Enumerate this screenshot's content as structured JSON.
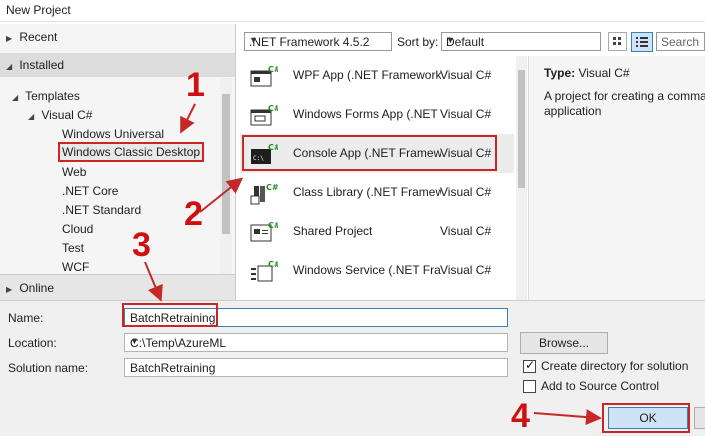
{
  "window": {
    "title": "New Project"
  },
  "left_panel": {
    "recent": "Recent",
    "installed": "Installed",
    "templates": "Templates",
    "visual_csharp": "Visual C#",
    "items": [
      "Windows Universal",
      "Windows Classic Desktop",
      "Web",
      ".NET Core",
      ".NET Standard",
      "Cloud",
      "Test",
      "WCF"
    ],
    "online": "Online"
  },
  "toolbar": {
    "framework": ".NET Framework 4.5.2",
    "sort_label": "Sort by:",
    "sort_value": "Default",
    "search_placeholder": "Search"
  },
  "templates": [
    {
      "name": "WPF App (.NET Framework)",
      "lang": "Visual C#"
    },
    {
      "name": "Windows Forms App (.NET Framework)",
      "lang": "Visual C#"
    },
    {
      "name": "Console App (.NET Framework)",
      "lang": "Visual C#"
    },
    {
      "name": "Class Library (.NET Framework)",
      "lang": "Visual C#"
    },
    {
      "name": "Shared Project",
      "lang": "Visual C#"
    },
    {
      "name": "Windows Service (.NET Framework)",
      "lang": "Visual C#"
    }
  ],
  "details": {
    "type_label": "Type:",
    "type_value": "Visual C#",
    "description": "A project for creating a command-line application"
  },
  "form": {
    "name_label": "Name:",
    "name_value": "BatchRetraining",
    "location_label": "Location:",
    "location_value": "C:\\Temp\\AzureML",
    "solution_label": "Solution name:",
    "solution_value": "BatchRetraining",
    "browse": "Browse...",
    "create_dir": "Create directory for solution",
    "add_source": "Add to Source Control",
    "ok": "OK"
  },
  "annotations": {
    "n1": "1",
    "n2": "2",
    "n3": "3",
    "n4": "4"
  },
  "colors": {
    "annotation_red": "#c62828",
    "selection_blue": "#cfe3f7"
  }
}
